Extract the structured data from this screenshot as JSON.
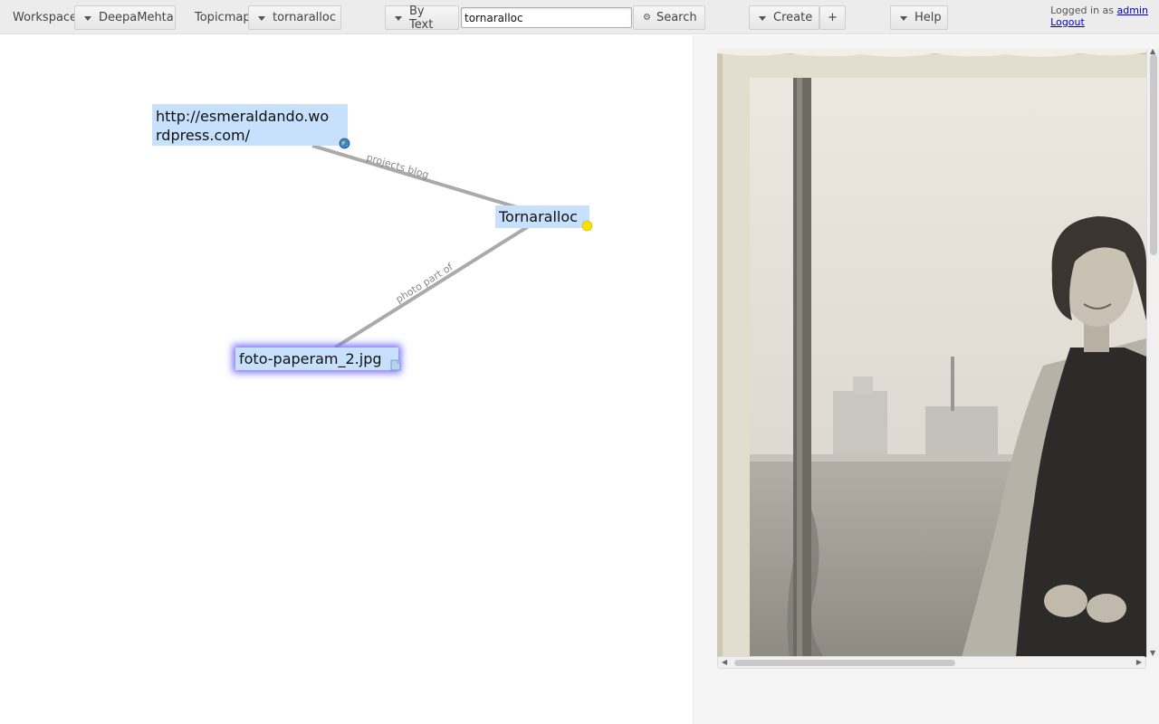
{
  "toolbar": {
    "workspace_label": "Workspace",
    "workspace_value": "DeepaMehta",
    "topicmap_label": "Topicmap",
    "topicmap_value": "tornaralloc",
    "search_mode": "By Text",
    "search_value": "tornaralloc",
    "search_button": "Search",
    "create_button": "Create",
    "plus_button": "+",
    "help_button": "Help"
  },
  "login": {
    "prefix": "Logged in as",
    "user": "admin",
    "logout": "Logout"
  },
  "topicmap": {
    "topics": [
      {
        "id": "url",
        "label": "http://esmeraldando.wo\nrdpress.com/",
        "icon": "globe-icon"
      },
      {
        "id": "tornaralloc",
        "label": "Tornaralloc",
        "icon": "yellow-dot-icon"
      },
      {
        "id": "photo",
        "label": "foto-paperam_2.jpg",
        "icon": "file-icon",
        "selected": true
      }
    ],
    "associations": [
      {
        "label": "projects blog",
        "from": "url",
        "to": "tornaralloc"
      },
      {
        "label": "photo part of",
        "from": "photo",
        "to": "tornaralloc"
      }
    ]
  },
  "detail": {
    "image_name": "foto-paperam_2.jpg"
  },
  "colors": {
    "topic_bg": "#c7e0fb",
    "selection_glow": "#7a6ef5",
    "assoc_line": "#aaaaaa",
    "link": "#0000cc"
  }
}
